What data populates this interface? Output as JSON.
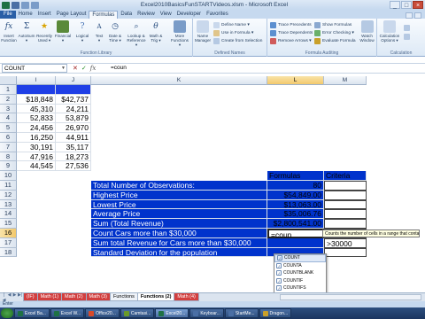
{
  "window": {
    "title": "Excel2010BasicsFunSTARTVideos.xlsm - Microsoft Excel",
    "controls": [
      "_",
      "□",
      "×"
    ]
  },
  "tabs": [
    "File",
    "Home",
    "Insert",
    "Page Layout",
    "Formulas",
    "Data",
    "Review",
    "View",
    "Developer",
    "Favorites"
  ],
  "active_tab": "Formulas",
  "ribbon": {
    "function_library": {
      "label": "Function Library",
      "buttons": [
        {
          "label": "Insert\nFunction",
          "icon": "fx-icon"
        },
        {
          "label": "AutoSum\n▾",
          "icon": "sigma-icon"
        },
        {
          "label": "Recently\nUsed ▾",
          "icon": "star-icon"
        },
        {
          "label": "Financial\n▾",
          "icon": "book-icon"
        },
        {
          "label": "Logical\n▾",
          "icon": "question-icon"
        },
        {
          "label": "Text\n▾",
          "icon": "text-icon"
        },
        {
          "label": "Date &\nTime ▾",
          "icon": "clock-icon"
        },
        {
          "label": "Lookup &\nReference ▾",
          "icon": "search-icon"
        },
        {
          "label": "Math &\nTrig ▾",
          "icon": "theta-icon"
        },
        {
          "label": "More\nFunctions ▾",
          "icon": "more-icon"
        }
      ]
    },
    "defined_names": {
      "label": "Defined Names",
      "name_manager": "Name\nManager",
      "items": [
        "Define Name ▾",
        "Use in Formula ▾",
        "Create from Selection"
      ]
    },
    "formula_auditing": {
      "label": "Formula Auditing",
      "items_left": [
        "Trace Precedents",
        "Trace Dependents",
        "Remove Arrows ▾"
      ],
      "items_right": [
        "Show Formulas",
        "Error Checking ▾",
        "Evaluate Formula"
      ],
      "watch_window": "Watch\nWindow"
    },
    "calculation": {
      "label": "Calculation",
      "options": "Calculation\nOptions ▾"
    }
  },
  "formula_bar": {
    "name_box": "COUNT",
    "buttons": [
      "✕",
      "✓",
      "fx"
    ],
    "content": "=coun"
  },
  "grid": {
    "columns": [
      {
        "name": "I",
        "selected": false
      },
      {
        "name": "J",
        "selected": false
      },
      {
        "name": "K",
        "selected": false
      },
      {
        "name": "L",
        "selected": true
      },
      {
        "name": "M",
        "selected": false
      }
    ],
    "rows": [
      "1",
      "2",
      "3",
      "4",
      "5",
      "6",
      "7",
      "8",
      "9",
      "10",
      "11",
      "12",
      "13",
      "14",
      "15",
      "16",
      "17",
      "18"
    ],
    "selected_row": "16",
    "data_i": [
      "$18,848",
      "45,310",
      "52,833",
      "24,456",
      "16,250",
      "30,191",
      "47,916",
      "44,545"
    ],
    "data_j": [
      "$42,737",
      "24,211",
      "53,879",
      "26,970",
      "44,911",
      "35,117",
      "18,273",
      "27,536"
    ],
    "labels": [
      "Total Number of Observations:",
      "Highest Price",
      "Lowest Price",
      "Average Price",
      "Sum (Total Revenue)",
      "Count Cars more than $30,000",
      "Sum total Revenue for Cars more than $30,000",
      "Standard Deviation for the population"
    ],
    "formulas_header": "Formulas",
    "criteria_header": "Criteria",
    "formulas_values": [
      "80",
      "$54,849.00",
      "$13,063.00",
      "$35,006.76",
      "$2,800,541.00",
      "=coun",
      "",
      ""
    ],
    "criteria_values": [
      "",
      "",
      "",
      "",
      "",
      ">30000",
      ">30000",
      ""
    ],
    "colors": {
      "blue_fill": "#1f3fe6",
      "label_fill": "#0033cc",
      "header_fill": "#0033cc"
    }
  },
  "autocomplete": {
    "tooltip": "Counts the number of cells in a range that contain numbers",
    "items": [
      "COUNT",
      "COUNTA",
      "COUNTBLANK",
      "COUNTIF",
      "COUNTIFS"
    ],
    "highlighted": "COUNT"
  },
  "sheet_tabs": {
    "tabs": [
      {
        "name": "(IF)",
        "color": "red"
      },
      {
        "name": "Math (1)",
        "color": "red"
      },
      {
        "name": "Math (2)",
        "color": "red"
      },
      {
        "name": "Math (3)",
        "color": "red"
      },
      {
        "name": "Functions",
        "color": "none"
      },
      {
        "name": "Functions (2)",
        "color": "active"
      },
      {
        "name": "Math (4)",
        "color": "red"
      }
    ]
  },
  "status_bar": {
    "mode": "Enter"
  },
  "taskbar": {
    "items": [
      {
        "label": "Excel Ba...",
        "color": "#1e7145"
      },
      {
        "label": "Excel W...",
        "color": "#1e7145"
      },
      {
        "label": "Office20...",
        "color": "#d84a2a"
      },
      {
        "label": "Camtasi...",
        "color": "#6a9a2a"
      },
      {
        "label": "Excel20...",
        "color": "#1e7145",
        "active": true
      },
      {
        "label": "Keyboar...",
        "color": "#4a6fa5"
      },
      {
        "label": "StartMe...",
        "color": "#4a6fa5"
      },
      {
        "label": "Dragon...",
        "color": "#c9a02a"
      }
    ]
  }
}
